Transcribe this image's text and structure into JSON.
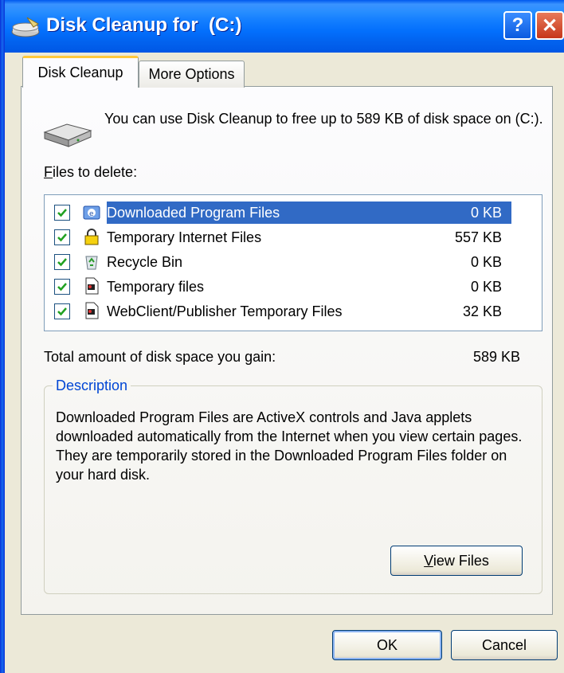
{
  "window": {
    "title": "Disk Cleanup for  (C:)"
  },
  "titlebar_buttons": {
    "help": "?",
    "close": "✕"
  },
  "tabs": [
    {
      "label": "Disk Cleanup",
      "active": true
    },
    {
      "label": "More Options",
      "active": false
    }
  ],
  "intro_text": "You can use Disk Cleanup to free up to 589 KB of disk space on  (C:).",
  "files_label": {
    "mnemonic": "F",
    "rest": "iles to delete:"
  },
  "files": [
    {
      "name": "Downloaded Program Files",
      "size": "0 KB",
      "checked": true,
      "icon": "ie-folder-icon",
      "selected": true
    },
    {
      "name": "Temporary Internet Files",
      "size": "557 KB",
      "checked": true,
      "icon": "lock-icon",
      "selected": false
    },
    {
      "name": "Recycle Bin",
      "size": "0 KB",
      "checked": true,
      "icon": "recycle-bin-icon",
      "selected": false
    },
    {
      "name": "Temporary files",
      "size": "0 KB",
      "checked": true,
      "icon": "document-icon",
      "selected": false
    },
    {
      "name": "WebClient/Publisher Temporary Files",
      "size": "32 KB",
      "checked": true,
      "icon": "document-icon",
      "selected": false
    }
  ],
  "total": {
    "label": "Total amount of disk space you gain:",
    "value": "589 KB"
  },
  "description": {
    "legend": "Description",
    "text": "Downloaded Program Files are ActiveX controls and Java applets downloaded automatically from the Internet when you view certain pages. They are temporarily stored in the Downloaded Program Files folder on your hard disk."
  },
  "buttons": {
    "view_files": {
      "mnemonic": "V",
      "rest": "iew Files"
    },
    "ok": "OK",
    "cancel": "Cancel"
  },
  "colors": {
    "titlebar": "#0058ee",
    "selection": "#316ac5",
    "legend": "#0046d5",
    "checkmark": "#21a121"
  }
}
